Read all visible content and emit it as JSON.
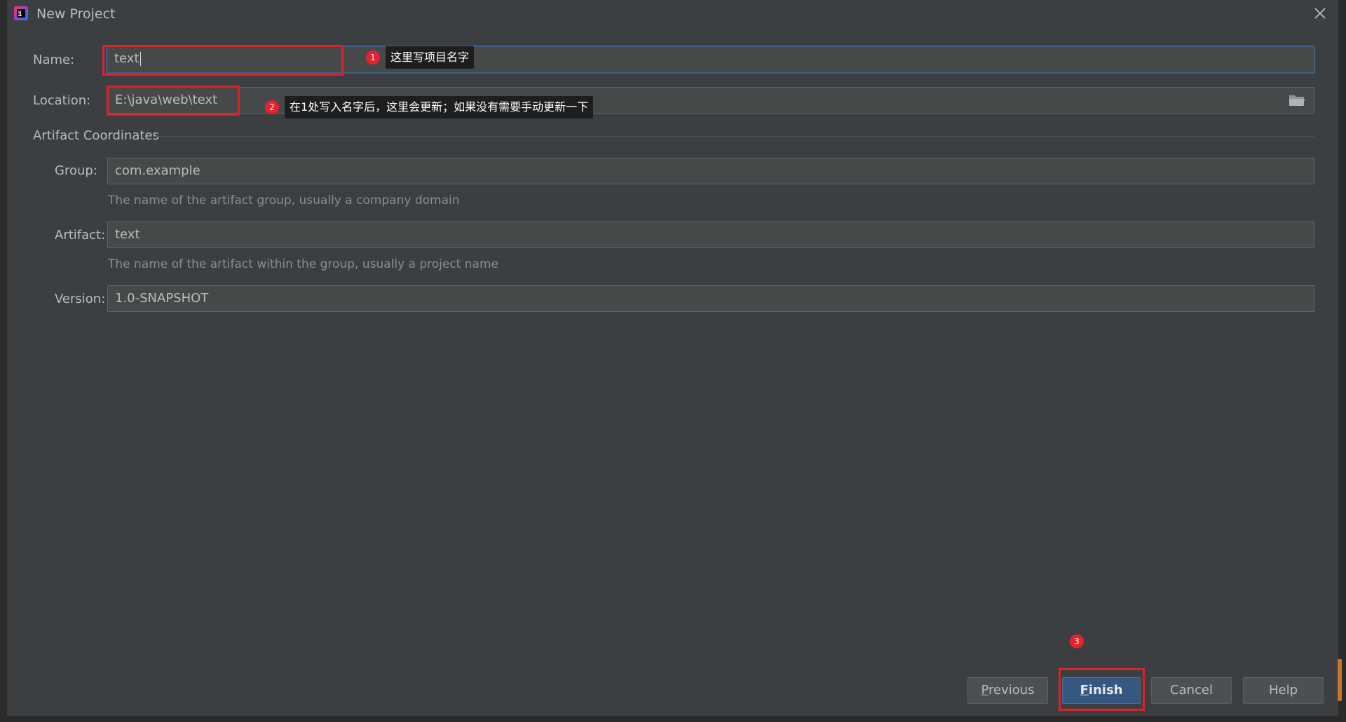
{
  "window": {
    "title": "New Project",
    "icon": "intellij-idea-icon",
    "close_icon": "close-icon"
  },
  "form": {
    "name": {
      "label": "Name:",
      "value": "text"
    },
    "location": {
      "label": "Location:",
      "value": "E:\\java\\web\\text",
      "browse_icon": "folder-icon"
    },
    "artifact_coordinates": {
      "title": "Artifact Coordinates",
      "group": {
        "label": "Group:",
        "value": "com.example",
        "hint": "The name of the artifact group, usually a company domain"
      },
      "artifact": {
        "label": "Artifact:",
        "value": "text",
        "hint": "The name of the artifact within the group, usually a project name"
      },
      "version": {
        "label": "Version:",
        "value": "1.0-SNAPSHOT"
      }
    }
  },
  "annotations": [
    {
      "number": "1",
      "text": "这里写项目名字"
    },
    {
      "number": "2",
      "text": "在1处写入名字后，这里会更新；如果没有需要手动更新一下"
    },
    {
      "number": "3",
      "text": ""
    }
  ],
  "buttons": {
    "previous": {
      "mnemonic": "P",
      "rest": "revious"
    },
    "finish": {
      "mnemonic": "F",
      "rest": "inish"
    },
    "cancel": "Cancel",
    "help": "Help"
  },
  "colors": {
    "dialog_bg": "#3c3f41",
    "field_bg": "#45494a",
    "focus_border": "#3d6185",
    "annotation_red": "#e0202a",
    "primary_button": "#365880"
  }
}
